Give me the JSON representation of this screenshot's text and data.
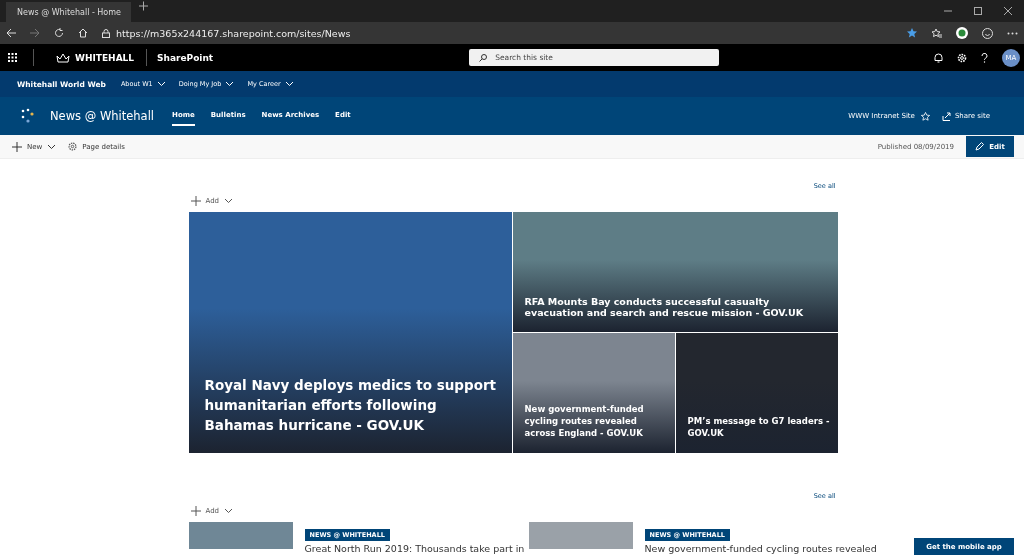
{
  "browser": {
    "tab_title": "News @ Whitehall - Home",
    "url": "https://m365x244167.sharepoint.com/sites/News"
  },
  "suite_bar": {
    "brand": "WHITEHALL",
    "app": "SharePoint",
    "search": {
      "placeholder": "Search this site"
    },
    "avatar": "MA"
  },
  "hub_nav": {
    "title": "Whitehall World Web",
    "items": [
      "About W1",
      "Doing My Job",
      "My Career"
    ]
  },
  "site_header": {
    "title": "News @ Whitehall",
    "nav": [
      {
        "label": "Home",
        "selected": true
      },
      {
        "label": "Bulletins",
        "selected": false
      },
      {
        "label": "News Archives",
        "selected": false
      },
      {
        "label": "Edit",
        "selected": false
      }
    ],
    "hub_link": "WWW Intranet Site",
    "share": "Share site"
  },
  "command_bar": {
    "new": "New",
    "page_details": "Page details",
    "published": "Published 08/09/2019",
    "edit": "Edit"
  },
  "hero": {
    "see_all": "See all",
    "add": "Add",
    "tiles": [
      {
        "title": "Royal Navy deploys medics to support humanitarian efforts following Bahamas hurricane - GOV.UK",
        "color": "#2d5f9a"
      },
      {
        "title": "RFA Mounts Bay conducts successful casualty evacuation and search and rescue mission - GOV.UK",
        "color": "#5e7d86"
      },
      {
        "title": "New government-funded cycling routes revealed across England - GOV.UK",
        "color": "#7d8590"
      },
      {
        "title": "PM’s message to G7 leaders - GOV.UK",
        "color": "#23272f"
      }
    ]
  },
  "news_list": {
    "see_all": "See all",
    "add": "Add",
    "items": [
      {
        "tag": "NEWS @ WHITEHALL",
        "title": "Great North Run 2019: Thousands take part in",
        "color": "#6f8796"
      },
      {
        "tag": "NEWS @ WHITEHALL",
        "title": "New government-funded cycling routes revealed",
        "color": "#9aa1a8"
      }
    ]
  },
  "mobile_app_button": "Get the mobile app"
}
